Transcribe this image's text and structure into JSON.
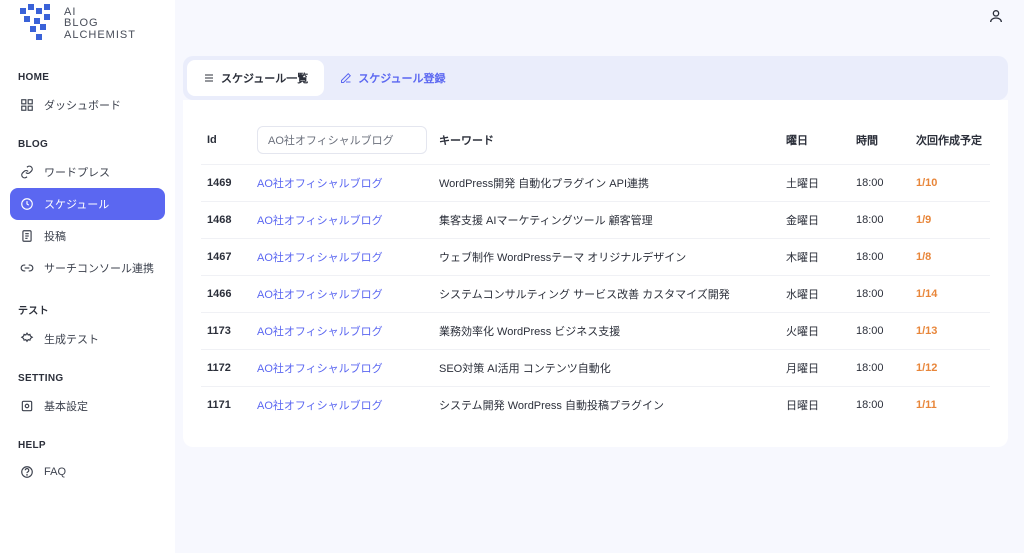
{
  "logo": {
    "line1": "AI",
    "line2": "BLOG",
    "line3": "ALCHEMIST"
  },
  "sidebar": {
    "sections": [
      {
        "title": "HOME",
        "items": [
          {
            "label": "ダッシュボード",
            "icon": "dashboard"
          }
        ]
      },
      {
        "title": "BLOG",
        "items": [
          {
            "label": "ワードプレス",
            "icon": "link"
          },
          {
            "label": "スケジュール",
            "icon": "clock",
            "active": true
          },
          {
            "label": "投稿",
            "icon": "doc"
          },
          {
            "label": "サーチコンソール連携",
            "icon": "chain"
          }
        ]
      },
      {
        "title": "テスト",
        "items": [
          {
            "label": "生成テスト",
            "icon": "gear"
          }
        ]
      },
      {
        "title": "SETTING",
        "items": [
          {
            "label": "基本設定",
            "icon": "settings"
          }
        ]
      },
      {
        "title": "HELP",
        "items": [
          {
            "label": "FAQ",
            "icon": "help"
          }
        ]
      }
    ]
  },
  "tabs": {
    "list": "スケジュール一覧",
    "register": "スケジュール登録"
  },
  "table": {
    "headers": {
      "id": "Id",
      "keyword": "キーワード",
      "day": "曜日",
      "time": "時間",
      "next": "次回作成予定"
    },
    "filterValue": "AO社オフィシャルブログ",
    "rows": [
      {
        "id": "1469",
        "blog": "AO社オフィシャルブログ",
        "keyword": "WordPress開発 自動化プラグイン API連携",
        "day": "土曜日",
        "time": "18:00",
        "next": "1/10"
      },
      {
        "id": "1468",
        "blog": "AO社オフィシャルブログ",
        "keyword": "集客支援 AIマーケティングツール 顧客管理",
        "day": "金曜日",
        "time": "18:00",
        "next": "1/9"
      },
      {
        "id": "1467",
        "blog": "AO社オフィシャルブログ",
        "keyword": "ウェブ制作 WordPressテーマ オリジナルデザイン",
        "day": "木曜日",
        "time": "18:00",
        "next": "1/8"
      },
      {
        "id": "1466",
        "blog": "AO社オフィシャルブログ",
        "keyword": "システムコンサルティング サービス改善 カスタマイズ開発",
        "day": "水曜日",
        "time": "18:00",
        "next": "1/14"
      },
      {
        "id": "1173",
        "blog": "AO社オフィシャルブログ",
        "keyword": "業務効率化 WordPress ビジネス支援",
        "day": "火曜日",
        "time": "18:00",
        "next": "1/13"
      },
      {
        "id": "1172",
        "blog": "AO社オフィシャルブログ",
        "keyword": "SEO対策 AI活用 コンテンツ自動化",
        "day": "月曜日",
        "time": "18:00",
        "next": "1/12"
      },
      {
        "id": "1171",
        "blog": "AO社オフィシャルブログ",
        "keyword": "システム開発 WordPress 自動投稿プラグイン",
        "day": "日曜日",
        "time": "18:00",
        "next": "1/11"
      }
    ]
  }
}
